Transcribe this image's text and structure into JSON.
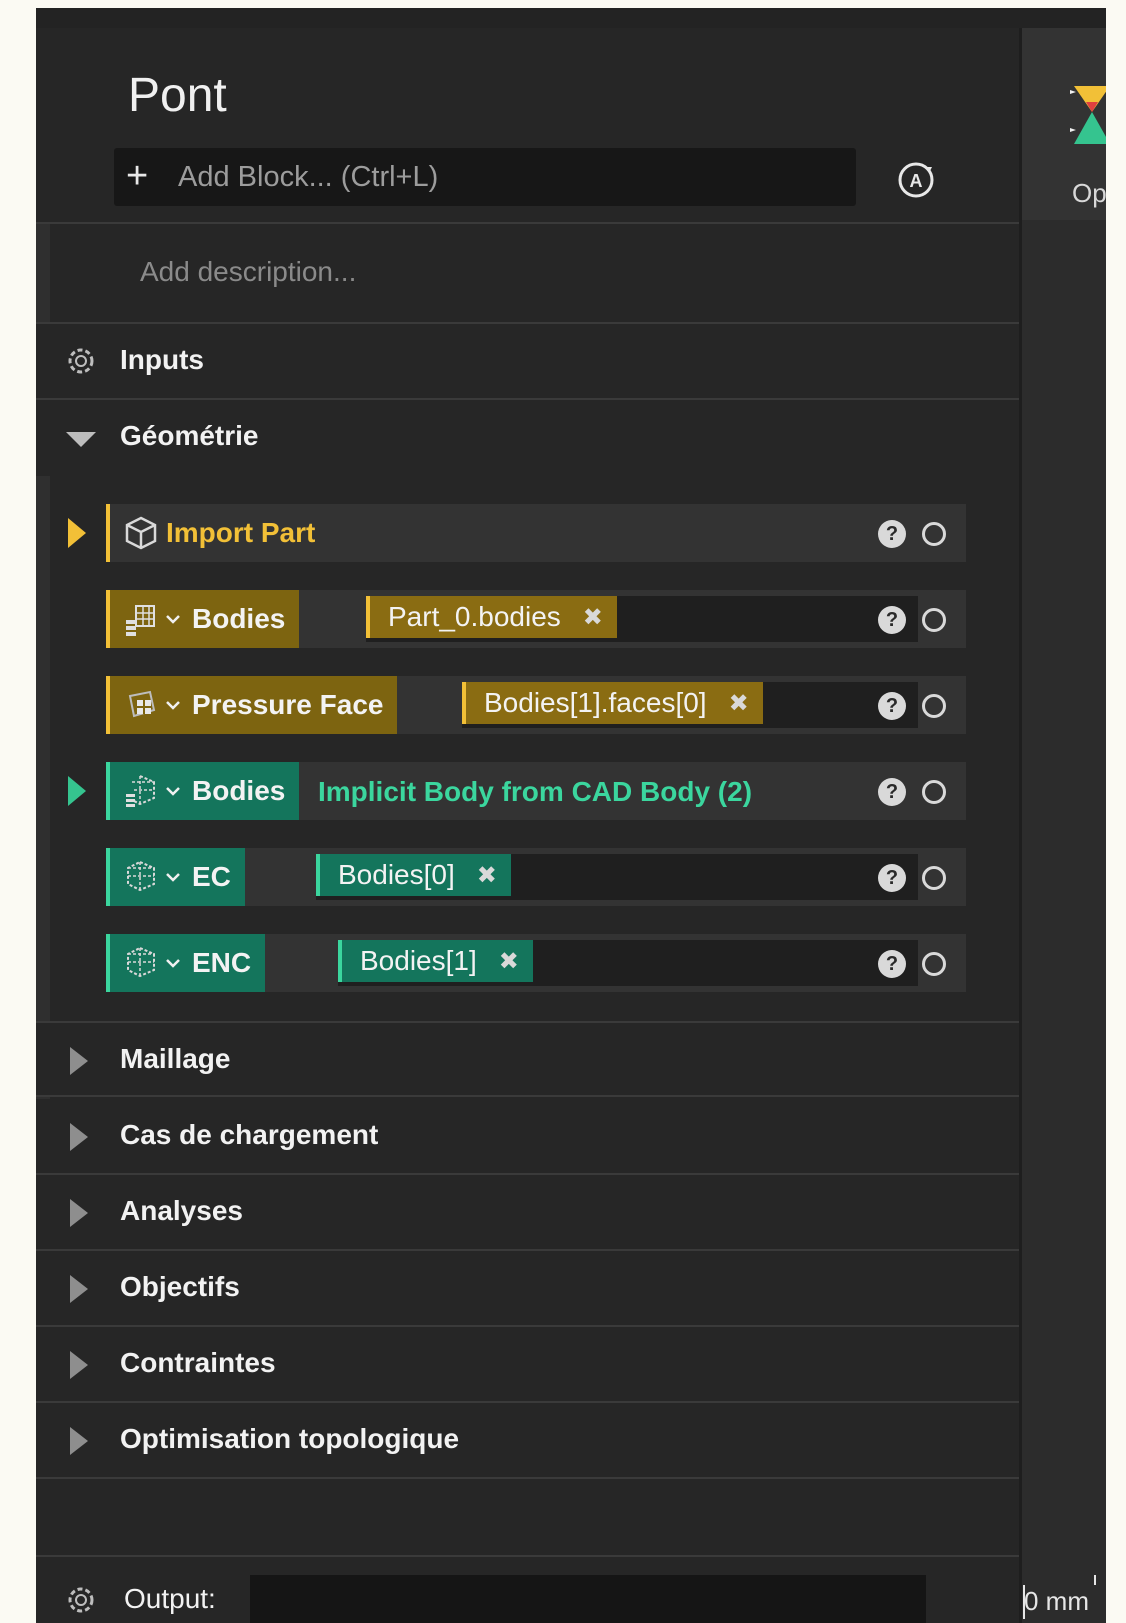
{
  "header": {
    "title": "Pont",
    "add_block_placeholder": "Add Block... (Ctrl+L)"
  },
  "description": {
    "placeholder": "Add description..."
  },
  "sections": {
    "inputs": "Inputs",
    "geometrie": "Géométrie",
    "maillage": "Maillage",
    "cas_de_chargement": "Cas de chargement",
    "analyses": "Analyses",
    "objectifs": "Objectifs",
    "contraintes": "Contraintes",
    "optimisation": "Optimisation topologique"
  },
  "blocks": [
    {
      "label": "Import Part"
    },
    {
      "label": "Bodies",
      "value": "Part_0.bodies"
    },
    {
      "label": "Pressure Face",
      "value": "Bodies[1].faces[0]"
    },
    {
      "label": "Bodies",
      "subtitle": "Implicit Body from CAD Body (2)"
    },
    {
      "label": "EC",
      "value": "Bodies[0]"
    },
    {
      "label": "ENC",
      "value": "Bodies[1]"
    }
  ],
  "block_actions": {
    "help": "?",
    "remove": "✖"
  },
  "output": {
    "label": "Output:"
  },
  "right_pane": {
    "label": "Op",
    "scale": "0 mm"
  },
  "colors": {
    "accent_yellow": "#f2c037",
    "accent_green": "#3bd69e",
    "panel_bg": "#262626"
  },
  "icons": [
    "plus-icon",
    "auto-a-icon",
    "gear-icon",
    "chevron-down-icon",
    "chevron-right-icon",
    "play-icon",
    "cube-icon",
    "bodies-icon",
    "face-icon",
    "implicit-body-icon",
    "help-icon",
    "status-circle-icon",
    "close-icon"
  ]
}
